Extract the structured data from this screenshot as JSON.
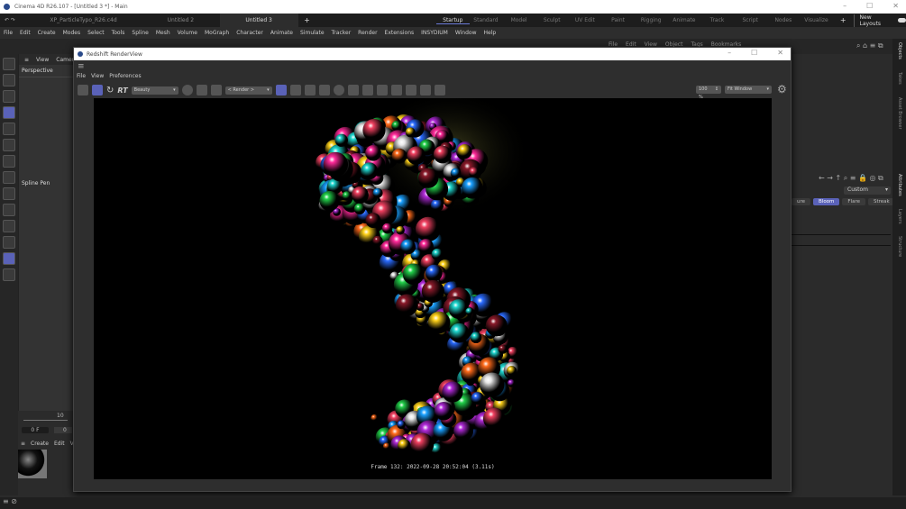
{
  "app": {
    "title": "Cinema 4D R26.107 - [Untitled 3 *] - Main"
  },
  "doc_tabs": [
    {
      "label": "XP_ParticleTypo_R26.c4d *"
    },
    {
      "label": "Untitled 2 *"
    },
    {
      "label": "Untitled 3 *"
    }
  ],
  "layouts": [
    "Startup",
    "Standard",
    "Model",
    "Sculpt",
    "UV Edit",
    "Paint",
    "Rigging",
    "Animate",
    "Track",
    "Script",
    "Nodes",
    "Visualize"
  ],
  "new_layouts": "New Layouts",
  "menu": [
    "File",
    "Edit",
    "Create",
    "Modes",
    "Select",
    "Tools",
    "Spline",
    "Mesh",
    "Volume",
    "MoGraph",
    "Character",
    "Animate",
    "Simulate",
    "Tracker",
    "Render",
    "Extensions",
    "INSYDIUM",
    "Window",
    "Help"
  ],
  "obj_menu": [
    "File",
    "Edit",
    "View",
    "Object",
    "Tags",
    "Bookmarks"
  ],
  "viewport": {
    "menu": [
      "View",
      "Cameras"
    ],
    "label": "Perspective",
    "tool": "Spline Pen"
  },
  "timeline": {
    "tick": "10",
    "frame": "0 F",
    "frame2": "0"
  },
  "material": {
    "menu": [
      "Create",
      "Edit",
      "V"
    ]
  },
  "renderview": {
    "title": "Redshift RenderView",
    "menu": [
      "File",
      "View",
      "Preferences"
    ],
    "rt": "RT",
    "aov": "Beauty",
    "camera": "< Render >",
    "zoom": "100 %",
    "fit": "Fit Window",
    "frame_info": "Frame  132:  2022-09-28  20:52:04  (3.11s)"
  },
  "attributes": {
    "preset": "Custom",
    "tabs": [
      {
        "label": "ure"
      },
      {
        "label": "Bloom"
      },
      {
        "label": "Flare"
      },
      {
        "label": "Streak"
      }
    ]
  },
  "side_tabs": [
    "Objects",
    "Takes",
    "Asset Browser",
    "Attributes",
    "Layers",
    "Structure"
  ]
}
